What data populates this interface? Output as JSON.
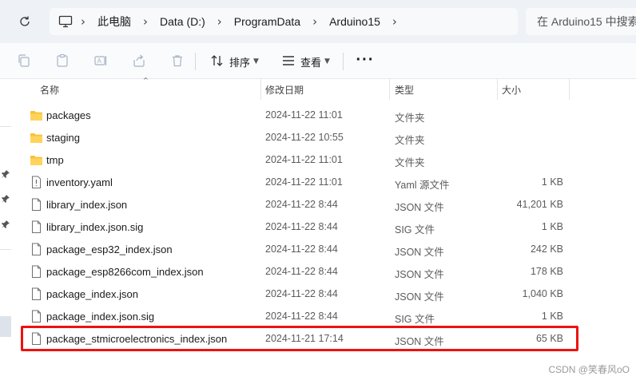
{
  "address_bar": {
    "breadcrumbs": [
      "此电脑",
      "Data (D:)",
      "ProgramData",
      "Arduino15"
    ],
    "search_placeholder": "在 Arduino15 中搜索"
  },
  "toolbar": {
    "sort_label": "排序",
    "view_label": "查看",
    "more_label": "···"
  },
  "columns": {
    "name": "名称",
    "date": "修改日期",
    "type": "类型",
    "size": "大小"
  },
  "files": [
    {
      "name": "packages",
      "date": "2024-11-22 11:01",
      "type": "文件夹",
      "size": "",
      "kind": "folder"
    },
    {
      "name": "staging",
      "date": "2024-11-22 10:55",
      "type": "文件夹",
      "size": "",
      "kind": "folder"
    },
    {
      "name": "tmp",
      "date": "2024-11-22 11:01",
      "type": "文件夹",
      "size": "",
      "kind": "folder"
    },
    {
      "name": "inventory.yaml",
      "date": "2024-11-22 11:01",
      "type": "Yaml 源文件",
      "size": "1 KB",
      "kind": "yaml"
    },
    {
      "name": "library_index.json",
      "date": "2024-11-22 8:44",
      "type": "JSON 文件",
      "size": "41,201 KB",
      "kind": "file"
    },
    {
      "name": "library_index.json.sig",
      "date": "2024-11-22 8:44",
      "type": "SIG 文件",
      "size": "1 KB",
      "kind": "file"
    },
    {
      "name": "package_esp32_index.json",
      "date": "2024-11-22 8:44",
      "type": "JSON 文件",
      "size": "242 KB",
      "kind": "file"
    },
    {
      "name": "package_esp8266com_index.json",
      "date": "2024-11-22 8:44",
      "type": "JSON 文件",
      "size": "178 KB",
      "kind": "file"
    },
    {
      "name": "package_index.json",
      "date": "2024-11-22 8:44",
      "type": "JSON 文件",
      "size": "1,040 KB",
      "kind": "file"
    },
    {
      "name": "package_index.json.sig",
      "date": "2024-11-22 8:44",
      "type": "SIG 文件",
      "size": "1 KB",
      "kind": "file"
    },
    {
      "name": "package_stmicroelectronics_index.json",
      "date": "2024-11-21 17:14",
      "type": "JSON 文件",
      "size": "65 KB",
      "kind": "file"
    }
  ],
  "highlight_color": "#ee1111",
  "folder_color": "#f8c13b",
  "watermark": "CSDN @笑春风oO"
}
